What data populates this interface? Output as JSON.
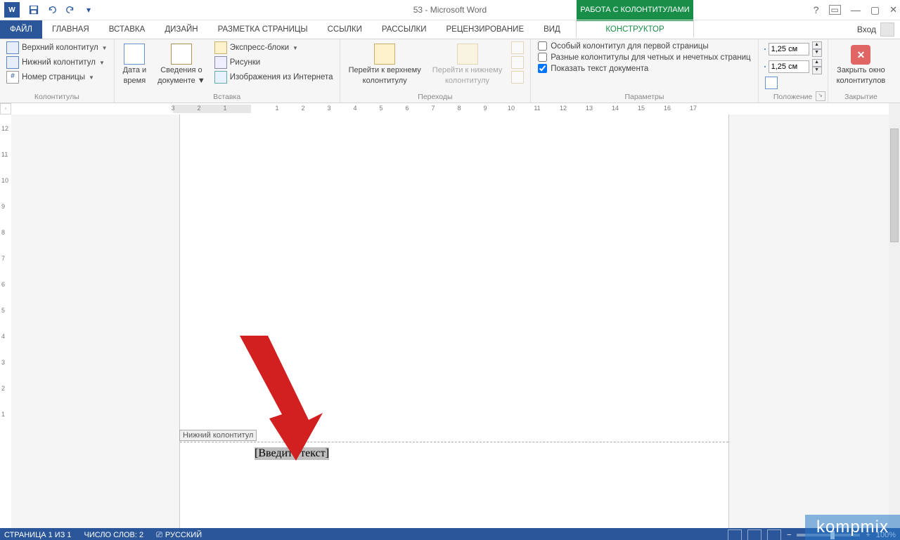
{
  "title": "53 - Microsoft Word",
  "contextualTabGroup": "РАБОТА С КОЛОНТИТУЛАМИ",
  "tabs": {
    "file": "ФАЙЛ",
    "home": "ГЛАВНАЯ",
    "insert": "ВСТАВКА",
    "design": "ДИЗАЙН",
    "layout": "РАЗМЕТКА СТРАНИЦЫ",
    "references": "ССЫЛКИ",
    "mailings": "РАССЫЛКИ",
    "review": "РЕЦЕНЗИРОВАНИЕ",
    "view": "ВИД",
    "context": "КОНСТРУКТОР"
  },
  "signIn": "Вход",
  "ribbon": {
    "grpHeaderFooter": {
      "label": "Колонтитулы",
      "header": "Верхний колонтитул",
      "footer": "Нижний колонтитул",
      "pagenum": "Номер страницы"
    },
    "grpInsert": {
      "label": "Вставка",
      "date_l1": "Дата и",
      "date_l2": "время",
      "docinfo_l1": "Сведения о",
      "docinfo_l2": "документе",
      "quick": "Экспресс-блоки",
      "pics": "Рисунки",
      "online": "Изображения из Интернета"
    },
    "grpNav": {
      "label": "Переходы",
      "prev_l1": "Перейти к верхнему",
      "prev_l2": "колонтитулу",
      "next_l1": "Перейти к нижнему",
      "next_l2": "колонтитулу",
      "linkPrev": ""
    },
    "grpOptions": {
      "label": "Параметры",
      "diffFirst": "Особый колонтитул для первой страницы",
      "diffOddEven": "Разные колонтитулы для четных и нечетных страниц",
      "showDoc": "Показать текст документа"
    },
    "grpPosition": {
      "label": "Положение",
      "top": {
        "value": "1,25 см"
      },
      "bottom": {
        "value": "1,25 см"
      }
    },
    "grpClose": {
      "label": "Закрытие",
      "close_l1": "Закрыть окно",
      "close_l2": "колонтитулов"
    }
  },
  "document": {
    "footerTag": "Нижний колонтитул",
    "footerPlaceholder": "[Введите текст]"
  },
  "hruler": {
    "ticks": [
      "3",
      "2",
      "1",
      "",
      "1",
      "2",
      "3",
      "4",
      "5",
      "6",
      "7",
      "8",
      "9",
      "10",
      "11",
      "12",
      "13",
      "14",
      "15",
      "16",
      "17"
    ]
  },
  "vruler": {
    "ticks": [
      "12",
      "11",
      "10",
      "9",
      "8",
      "7",
      "6",
      "5",
      "4",
      "3",
      "2",
      "1"
    ]
  },
  "status": {
    "page": "СТРАНИЦА 1 ИЗ 1",
    "words": "ЧИСЛО СЛОВ: 2",
    "lang": "РУССКИЙ",
    "zoom": "100%"
  },
  "watermark": "kompmix"
}
